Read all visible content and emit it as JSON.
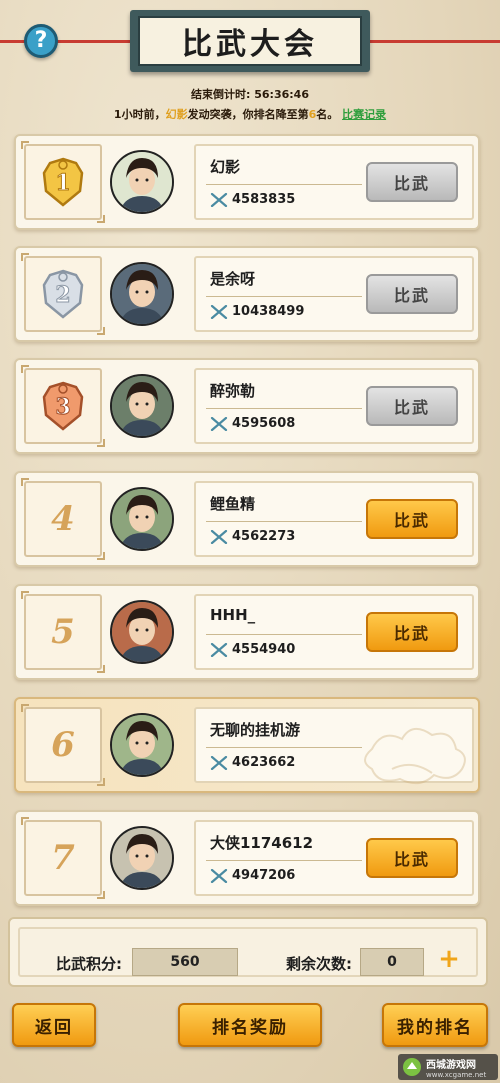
{
  "header": {
    "title": "比武大会",
    "help_icon": "question-icon",
    "help_label": "?"
  },
  "timer": {
    "label": "结束倒计时:",
    "value": "56:36:46"
  },
  "notice": {
    "prefix": "1小时前，",
    "attacker": "幻影",
    "middle": "发动突袭，你排名降至第",
    "rank": "6",
    "suffix": "名。",
    "link": "比赛记录"
  },
  "entries": [
    {
      "rank": "1",
      "medal": "gold",
      "name": "幻影",
      "power": "4583835",
      "button": "比武",
      "button_state": "disabled"
    },
    {
      "rank": "2",
      "medal": "silver",
      "name": "是余呀",
      "power": "10438499",
      "button": "比武",
      "button_state": "disabled"
    },
    {
      "rank": "3",
      "medal": "bronze",
      "name": "醉弥勒",
      "power": "4595608",
      "button": "比武",
      "button_state": "disabled"
    },
    {
      "rank": "4",
      "medal": "",
      "name": "鲤鱼精",
      "power": "4562273",
      "button": "比武",
      "button_state": "active"
    },
    {
      "rank": "5",
      "medal": "",
      "name": "HHH_",
      "power": "4554940",
      "button": "比武",
      "button_state": "active"
    },
    {
      "rank": "6",
      "medal": "",
      "name": "无聊的挂机游",
      "power": "4623662",
      "button": "",
      "button_state": "self"
    },
    {
      "rank": "7",
      "medal": "",
      "name": "大侠1174612",
      "power": "4947206",
      "button": "比武",
      "button_state": "active"
    }
  ],
  "stats": {
    "score_label": "比武积分:",
    "score_value": "560",
    "remaining_label": "剩余次数:",
    "remaining_value": "0"
  },
  "footer": {
    "back": "返回",
    "rewards": "排名奖励",
    "my_rank": "我的排名"
  },
  "watermark": {
    "title": "西城游戏网",
    "sub": "www.xcgame.net"
  },
  "colors": {
    "accent_orange": "#f09a10",
    "disabled_gray": "#b9b9b9",
    "banner": "#3f5a5c",
    "highlight_name": "#e0a020",
    "link_green": "#2e9e3c"
  }
}
